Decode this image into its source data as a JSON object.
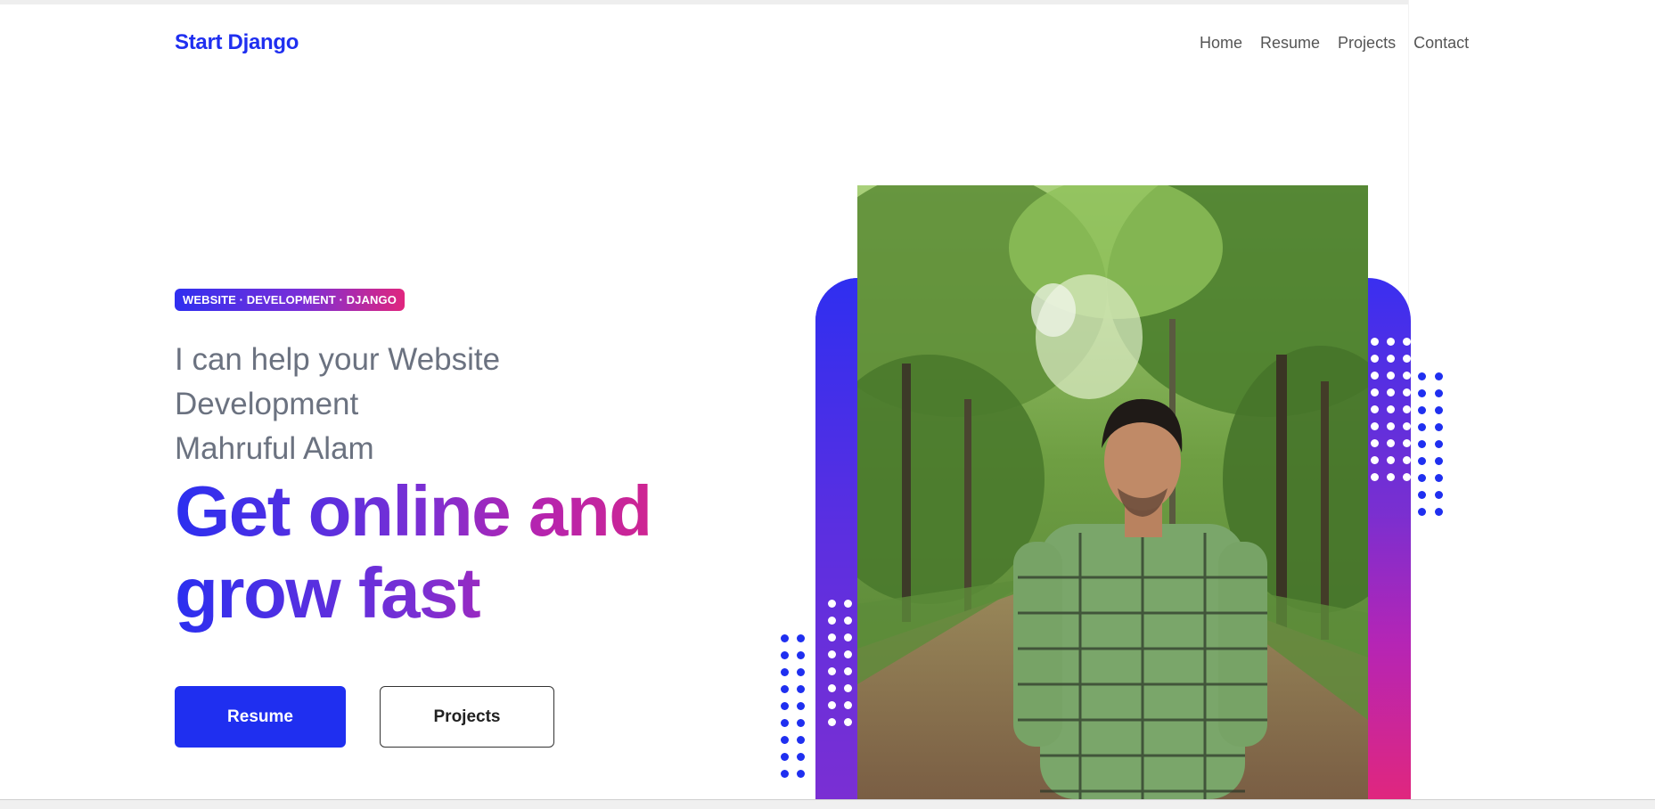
{
  "header": {
    "brand": "Start Django",
    "nav": [
      {
        "label": "Home"
      },
      {
        "label": "Resume"
      },
      {
        "label": "Projects"
      },
      {
        "label": "Contact"
      }
    ]
  },
  "hero": {
    "tag": "WEBSITE · DEVELOPMENT · DJANGO",
    "intro_lines": [
      "I can help your Website",
      "Development",
      "Mahruful Alam"
    ],
    "headline_lines": [
      "Get online and",
      "grow fast"
    ],
    "buttons": {
      "resume": "Resume",
      "projects": "Projects"
    },
    "photo": {
      "subject": "man in green checked shirt standing on a tree-lined forest path",
      "icon": "portrait-photo"
    }
  },
  "colors": {
    "brand_blue": "#1f2ff0",
    "gradient_purple": "#7a2fd3",
    "gradient_pink": "#e0267e",
    "nav_text": "#555555",
    "intro_text": "#6b7280"
  }
}
